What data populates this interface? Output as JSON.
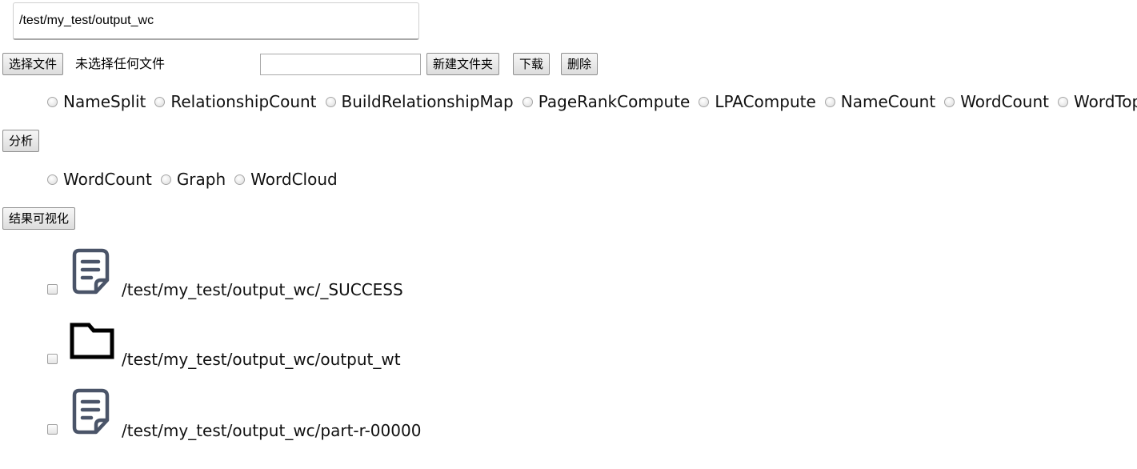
{
  "path_input": {
    "value": "/test/my_test/output_wc"
  },
  "upload": {
    "choose_file_label": "选择文件",
    "file_status": "未选择任何文件"
  },
  "toolbar": {
    "new_folder_input_value": "",
    "new_folder_label": "新建文件夹",
    "download_label": "下载",
    "delete_label": "删除"
  },
  "analysis": {
    "options": [
      "NameSplit",
      "RelationshipCount",
      "BuildRelationshipMap",
      "PageRankCompute",
      "LPACompute",
      "NameCount",
      "WordCount",
      "WordTop"
    ],
    "button_label": "分析"
  },
  "visualization": {
    "options": [
      "WordCount",
      "Graph",
      "WordCloud"
    ],
    "button_label": "结果可视化"
  },
  "files": [
    {
      "icon": "document-icon",
      "path": "/test/my_test/output_wc/_SUCCESS"
    },
    {
      "icon": "folder-icon",
      "path": "/test/my_test/output_wc/output_wt"
    },
    {
      "icon": "document-icon",
      "path": "/test/my_test/output_wc/part-r-00000"
    }
  ]
}
